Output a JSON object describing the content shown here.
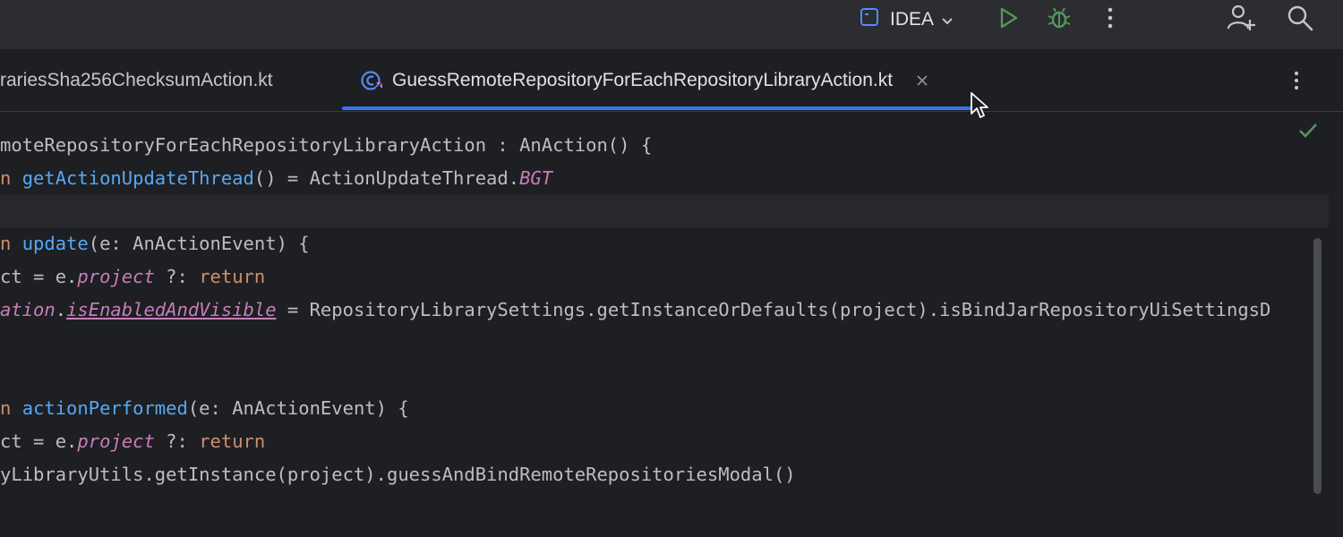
{
  "toolbar": {
    "project_name": "IDEA",
    "icons": [
      "project-config-icon",
      "chevron-down-icon",
      "run-icon",
      "debug-icon",
      "more-vertical-icon",
      "add-user-icon",
      "search-icon"
    ],
    "colors": {
      "run": "#57965c",
      "debug": "#57965c"
    }
  },
  "tabs": [
    {
      "label": "rariesSha256ChecksumAction.kt",
      "active": false
    },
    {
      "label": "GuessRemoteRepositoryForEachRepositoryLibraryAction.kt",
      "active": true
    }
  ],
  "accent_color": "#3574f0",
  "editor": {
    "lines": [
      {
        "parts": [
          {
            "t": "moteRepositoryForEachRepositoryLibraryAction : AnAction() {",
            "c": ""
          }
        ]
      },
      {
        "parts": [
          {
            "t": "n ",
            "c": "kw"
          },
          {
            "t": "getActionUpdateThread",
            "c": "fn"
          },
          {
            "t": "() = ActionUpdateThread.",
            "c": ""
          },
          {
            "t": "BGT",
            "c": "prop"
          }
        ]
      },
      {
        "parts": []
      },
      {
        "parts": [
          {
            "t": "n ",
            "c": "kw"
          },
          {
            "t": "update",
            "c": "fn"
          },
          {
            "t": "(e: AnActionEvent) {",
            "c": ""
          }
        ]
      },
      {
        "parts": [
          {
            "t": "ct = e.",
            "c": ""
          },
          {
            "t": "project",
            "c": "prop"
          },
          {
            "t": " ?: ",
            "c": ""
          },
          {
            "t": "return",
            "c": "kw"
          }
        ]
      },
      {
        "parts": [
          {
            "t": "ation",
            "c": "prop"
          },
          {
            "t": ".",
            "c": ""
          },
          {
            "t": "isEnabledAndVisible",
            "c": "prop-u"
          },
          {
            "t": " = RepositoryLibrarySettings.getInstanceOrDefaults(project).isBindJarRepositoryUiSettingsD",
            "c": ""
          }
        ]
      },
      {
        "parts": []
      },
      {
        "parts": []
      },
      {
        "parts": [
          {
            "t": "n ",
            "c": "kw"
          },
          {
            "t": "actionPerformed",
            "c": "fn"
          },
          {
            "t": "(e: AnActionEvent) {",
            "c": ""
          }
        ]
      },
      {
        "parts": [
          {
            "t": "ct = e.",
            "c": ""
          },
          {
            "t": "project",
            "c": "prop"
          },
          {
            "t": " ?: ",
            "c": ""
          },
          {
            "t": "return",
            "c": "kw"
          }
        ]
      },
      {
        "parts": [
          {
            "t": "yLibraryUtils.getInstance(project).guessAndBindRemoteRepositoriesModal()",
            "c": ""
          }
        ]
      }
    ]
  }
}
